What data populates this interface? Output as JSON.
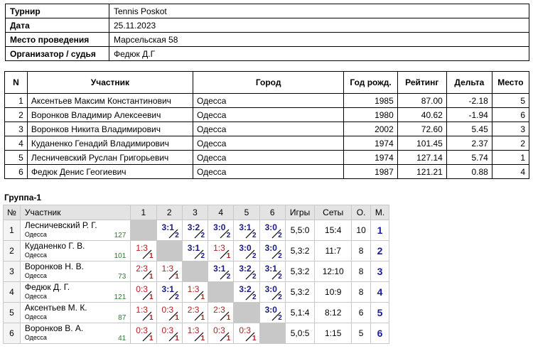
{
  "info": [
    {
      "label": "Турнир",
      "value": "Tennis Poskot"
    },
    {
      "label": "Дата",
      "value": "25.11.2023"
    },
    {
      "label": "Место проведения",
      "value": "Марсельская 58"
    },
    {
      "label": "Организатор / судья",
      "value": "Федюк Д.Г"
    }
  ],
  "players": {
    "headers": [
      "N",
      "Участник",
      "Город",
      "Год рожд.",
      "Рейтинг",
      "Дельта",
      "Место"
    ],
    "rows": [
      [
        "1",
        "Аксентьев Максим Константинович",
        "Одесса",
        "1985",
        "87.00",
        "-2.18",
        "5"
      ],
      [
        "2",
        "Воронков Владимир Алексеевич",
        "Одесса",
        "1980",
        "40.62",
        "-1.94",
        "6"
      ],
      [
        "3",
        "Воронков Никита Владимирович",
        "Одесса",
        "2002",
        "72.60",
        "5.45",
        "3"
      ],
      [
        "4",
        "Куданенко Генадий Владимирович",
        "Одесса",
        "1974",
        "101.45",
        "2.37",
        "2"
      ],
      [
        "5",
        "Лесничевский Руслан Григорьевич",
        "Одесса",
        "1974",
        "127.14",
        "5.74",
        "1"
      ],
      [
        "6",
        "Федюк Денис Геогиевич",
        "Одесса",
        "1987",
        "121.21",
        "0.88",
        "4"
      ]
    ]
  },
  "group": {
    "title": "Группа-1",
    "headers": [
      "№",
      "Участник",
      "1",
      "2",
      "3",
      "4",
      "5",
      "6",
      "Игры",
      "Сеты",
      "О.",
      "М."
    ],
    "rows": [
      {
        "n": "1",
        "name": "Лесничевский Р. Г.",
        "city": "Одесса",
        "rating": "127",
        "cells": [
          null,
          [
            "3:1",
            "2"
          ],
          [
            "3:2",
            "2"
          ],
          [
            "3:0",
            "2"
          ],
          [
            "3:1",
            "2"
          ],
          [
            "3:0",
            "2"
          ]
        ],
        "games": "5,5:0",
        "sets": "15:4",
        "pts": "10",
        "place": "1"
      },
      {
        "n": "2",
        "name": "Куданенко Г. В.",
        "city": "Одесса",
        "rating": "101",
        "cells": [
          [
            "1:3",
            "1"
          ],
          null,
          [
            "3:1",
            "2"
          ],
          [
            "1:3",
            "1"
          ],
          [
            "3:0",
            "2"
          ],
          [
            "3:0",
            "2"
          ]
        ],
        "games": "5,3:2",
        "sets": "11:7",
        "pts": "8",
        "place": "2"
      },
      {
        "n": "3",
        "name": "Воронков Н. В.",
        "city": "Одесса",
        "rating": "73",
        "cells": [
          [
            "2:3",
            "1"
          ],
          [
            "1:3",
            "1"
          ],
          null,
          [
            "3:1",
            "2"
          ],
          [
            "3:2",
            "2"
          ],
          [
            "3:1",
            "2"
          ]
        ],
        "games": "5,3:2",
        "sets": "12:10",
        "pts": "8",
        "place": "3"
      },
      {
        "n": "4",
        "name": "Федюк Д. Г.",
        "city": "Одесса",
        "rating": "121",
        "cells": [
          [
            "0:3",
            "1"
          ],
          [
            "3:1",
            "2"
          ],
          [
            "1:3",
            "1"
          ],
          null,
          [
            "3:2",
            "2"
          ],
          [
            "3:0",
            "2"
          ]
        ],
        "games": "5,3:2",
        "sets": "10:9",
        "pts": "8",
        "place": "4"
      },
      {
        "n": "5",
        "name": "Аксентьев М. К.",
        "city": "Одесса",
        "rating": "87",
        "cells": [
          [
            "1:3",
            "1"
          ],
          [
            "0:3",
            "1"
          ],
          [
            "2:3",
            "1"
          ],
          [
            "2:3",
            "1"
          ],
          null,
          [
            "3:0",
            "2"
          ]
        ],
        "games": "5,1:4",
        "sets": "8:12",
        "pts": "6",
        "place": "5"
      },
      {
        "n": "6",
        "name": "Воронков В. А.",
        "city": "Одесса",
        "rating": "41",
        "cells": [
          [
            "0:3",
            "1"
          ],
          [
            "0:3",
            "1"
          ],
          [
            "1:3",
            "1"
          ],
          [
            "0:3",
            "1"
          ],
          [
            "0:3",
            "1"
          ],
          null
        ],
        "games": "5,0:5",
        "sets": "1:15",
        "pts": "5",
        "place": "6"
      }
    ]
  }
}
